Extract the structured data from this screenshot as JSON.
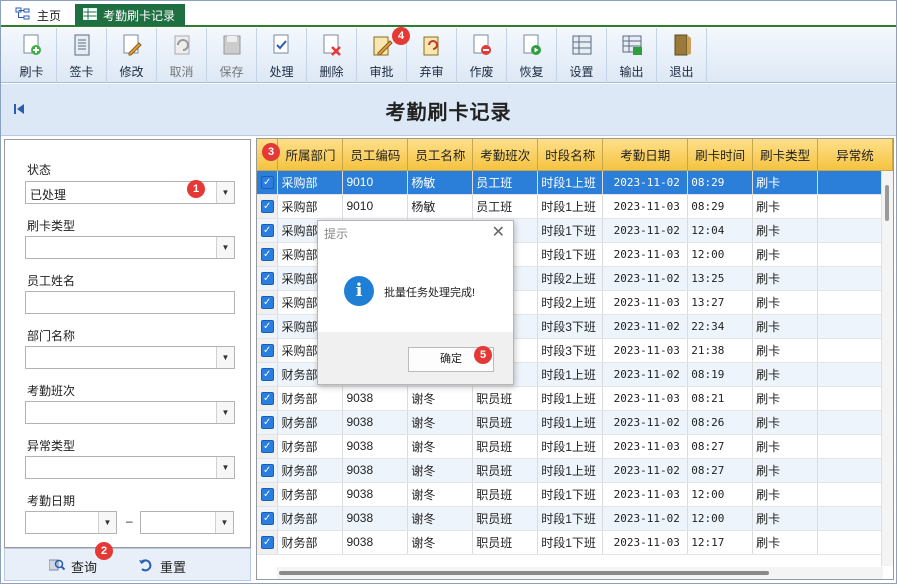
{
  "tabs": {
    "home": "主页",
    "active": "考勤刷卡记录"
  },
  "toolbar": [
    {
      "label": "刷卡",
      "icon": "add-page-icon",
      "disabled": false
    },
    {
      "label": "签卡",
      "icon": "document-icon",
      "disabled": false
    },
    {
      "label": "修改",
      "icon": "edit-icon",
      "disabled": false
    },
    {
      "label": "取消",
      "icon": "undo-icon",
      "disabled": true
    },
    {
      "label": "保存",
      "icon": "save-icon",
      "disabled": true
    },
    {
      "label": "处理",
      "icon": "process-icon",
      "disabled": false
    },
    {
      "label": "删除",
      "icon": "delete-icon",
      "disabled": false
    },
    {
      "label": "审批",
      "icon": "approve-icon",
      "disabled": false
    },
    {
      "label": "弃审",
      "icon": "unapprove-icon",
      "disabled": false
    },
    {
      "label": "作废",
      "icon": "void-icon",
      "disabled": false
    },
    {
      "label": "恢复",
      "icon": "restore-icon",
      "disabled": false
    },
    {
      "label": "设置",
      "icon": "settings-icon",
      "disabled": false
    },
    {
      "label": "输出",
      "icon": "export-icon",
      "disabled": false
    },
    {
      "label": "退出",
      "icon": "exit-icon",
      "disabled": false
    }
  ],
  "page_title": "考勤刷卡记录",
  "filters": {
    "status_label": "状态",
    "status_value": "已处理",
    "card_type_label": "刷卡类型",
    "employee_name_label": "员工姓名",
    "dept_label": "部门名称",
    "shift_label": "考勤班次",
    "abnormal_label": "异常类型",
    "date_label": "考勤日期",
    "date_sep": "–"
  },
  "actions": {
    "query": "查询",
    "reset": "重置"
  },
  "grid": {
    "columns": [
      "所属部门",
      "员工编码",
      "员工名称",
      "考勤班次",
      "时段名称",
      "考勤日期",
      "刷卡时间",
      "刷卡类型",
      "异常统"
    ],
    "rows": [
      [
        "采购部",
        "9010",
        "杨敏",
        "员工班",
        "时段1上班",
        "2023-11-02",
        "08:29",
        "刷卡"
      ],
      [
        "采购部",
        "9010",
        "杨敏",
        "员工班",
        "时段1上班",
        "2023-11-03",
        "08:29",
        "刷卡"
      ],
      [
        "采购部",
        "",
        "",
        "",
        "时段1下班",
        "2023-11-02",
        "12:04",
        "刷卡"
      ],
      [
        "采购部",
        "",
        "",
        "",
        "时段1下班",
        "2023-11-03",
        "12:00",
        "刷卡"
      ],
      [
        "采购部",
        "",
        "",
        "",
        "时段2上班",
        "2023-11-02",
        "13:25",
        "刷卡"
      ],
      [
        "采购部",
        "",
        "",
        "",
        "时段2上班",
        "2023-11-03",
        "13:27",
        "刷卡"
      ],
      [
        "采购部",
        "",
        "",
        "",
        "时段3下班",
        "2023-11-02",
        "22:34",
        "刷卡"
      ],
      [
        "采购部",
        "",
        "",
        "",
        "时段3下班",
        "2023-11-03",
        "21:38",
        "刷卡"
      ],
      [
        "财务部",
        "",
        "",
        "",
        "时段1上班",
        "2023-11-02",
        "08:19",
        "刷卡"
      ],
      [
        "财务部",
        "9038",
        "谢冬",
        "职员班",
        "时段1上班",
        "2023-11-03",
        "08:21",
        "刷卡"
      ],
      [
        "财务部",
        "9038",
        "谢冬",
        "职员班",
        "时段1上班",
        "2023-11-02",
        "08:26",
        "刷卡"
      ],
      [
        "财务部",
        "9038",
        "谢冬",
        "职员班",
        "时段1上班",
        "2023-11-03",
        "08:27",
        "刷卡"
      ],
      [
        "财务部",
        "9038",
        "谢冬",
        "职员班",
        "时段1上班",
        "2023-11-02",
        "08:27",
        "刷卡"
      ],
      [
        "财务部",
        "9038",
        "谢冬",
        "职员班",
        "时段1下班",
        "2023-11-03",
        "12:00",
        "刷卡"
      ],
      [
        "财务部",
        "9038",
        "谢冬",
        "职员班",
        "时段1下班",
        "2023-11-02",
        "12:00",
        "刷卡"
      ],
      [
        "财务部",
        "9038",
        "谢冬",
        "职员班",
        "时段1下班",
        "2023-11-03",
        "12:17",
        "刷卡"
      ]
    ]
  },
  "dialog": {
    "title": "提示",
    "message": "批量任务处理完成!",
    "ok": "确定"
  },
  "badges": [
    "1",
    "2",
    "3",
    "4",
    "5"
  ]
}
